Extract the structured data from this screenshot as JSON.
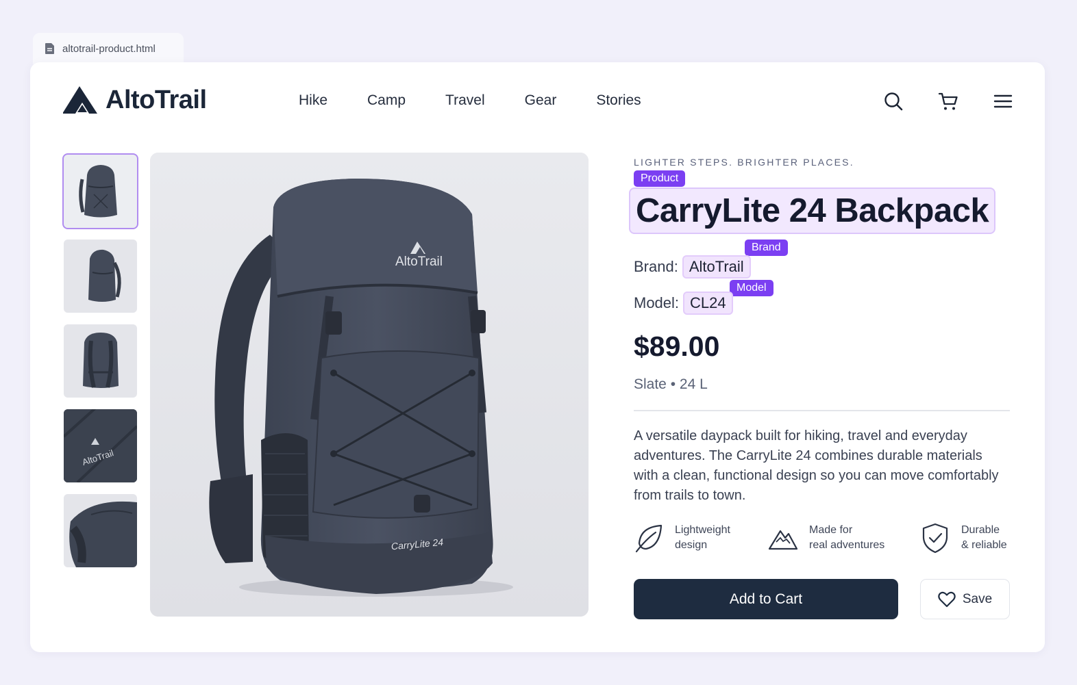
{
  "tab": {
    "filename": "altotrail-product.html",
    "icon": "file-icon"
  },
  "header": {
    "brand": "AltoTrail",
    "nav": [
      "Hike",
      "Camp",
      "Travel",
      "Gear",
      "Stories"
    ],
    "icons": [
      "search-icon",
      "cart-icon",
      "menu-icon"
    ]
  },
  "gallery": {
    "thumbnails": [
      "front-view",
      "side-view",
      "back-view",
      "logo-detail",
      "top-detail"
    ],
    "active_index": 0,
    "main_image": {
      "logo_text": "AltoTrail",
      "model_text": "CarryLite 24"
    }
  },
  "product": {
    "tagline": "LIGHTER STEPS. BRIGHTER PLACES.",
    "labels": {
      "product": "Product",
      "brand": "Brand",
      "model": "Model"
    },
    "title": "CarryLite 24 Backpack",
    "brand_label": "Brand:",
    "brand": "AltoTrail",
    "model_label": "Model:",
    "model": "CL24",
    "price": "$89.00",
    "variant": "Slate • 24 L",
    "description": "A versatile daypack built for hiking, travel and everyday adventures. The CarryLite 24 combines durable materials with a clean, functional design so you can move comfortably from trails to town.",
    "features": [
      {
        "icon": "leaf-icon",
        "line1": "Lightweight",
        "line2": "design"
      },
      {
        "icon": "mountain-icon",
        "line1": "Made for",
        "line2": "real adventures"
      },
      {
        "icon": "shield-check-icon",
        "line1": "Durable",
        "line2": "& reliable"
      }
    ],
    "actions": {
      "add_to_cart": "Add to Cart",
      "save": "Save"
    }
  },
  "colors": {
    "accent_purple": "#7b3ff2",
    "highlight": "#f1e4fd",
    "primary_button": "#1e2c40",
    "background": "#f1f0fa"
  }
}
